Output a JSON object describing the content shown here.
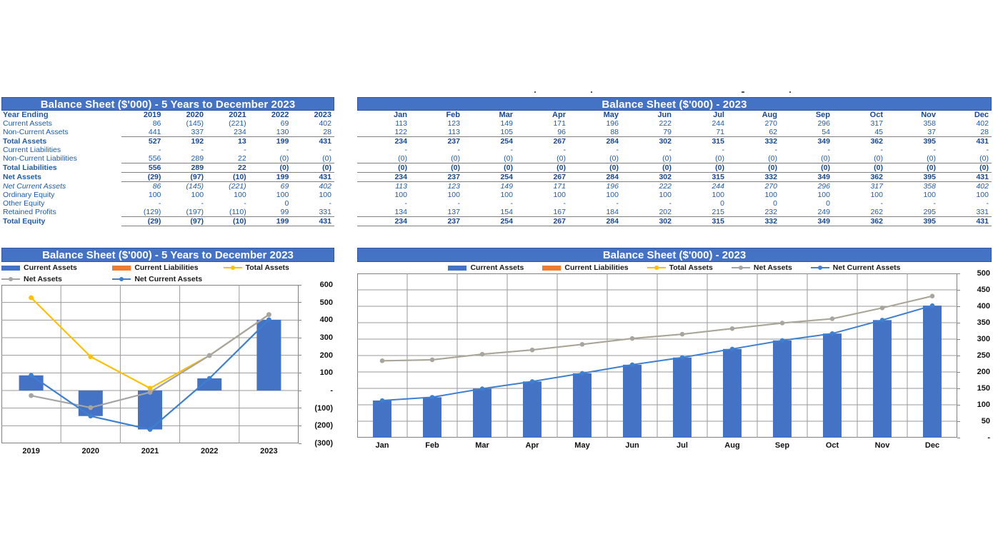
{
  "colors": {
    "header_blue": "#4472C4",
    "text_blue": "#1F5BA8",
    "bar_blue": "#4472C4",
    "series_orange": "#ED7D31",
    "series_yellow": "#FFC000",
    "series_gray": "#A5A5A5",
    "series_blue_line": "#3D7FD1",
    "rule_gray": "#808080"
  },
  "annual_table": {
    "title": "Balance Sheet ($'000) - 5 Years to December 2023",
    "row_header_label": "Year Ending",
    "columns": [
      "2019",
      "2020",
      "2021",
      "2022",
      "2023"
    ],
    "rows": [
      {
        "label": "Current Assets",
        "style": "plain",
        "rule": "none",
        "values": [
          "86",
          "(145)",
          "(221)",
          "69",
          "402"
        ]
      },
      {
        "label": "Non-Current Assets",
        "style": "plain",
        "rule": "bottom",
        "values": [
          "441",
          "337",
          "234",
          "130",
          "28"
        ]
      },
      {
        "label": "Total Assets",
        "style": "bold",
        "rule": "none",
        "values": [
          "527",
          "192",
          "13",
          "199",
          "431"
        ]
      },
      {
        "label": "Current Liabilities",
        "style": "plain",
        "rule": "none",
        "values": [
          "-",
          "-",
          "-",
          "-",
          "-"
        ]
      },
      {
        "label": "Non-Current Liabilities",
        "style": "plain",
        "rule": "bottom",
        "values": [
          "556",
          "289",
          "22",
          "(0)",
          "(0)"
        ]
      },
      {
        "label": "Total Liabilities",
        "style": "bold",
        "rule": "bottom",
        "values": [
          "556",
          "289",
          "22",
          "(0)",
          "(0)"
        ]
      },
      {
        "label": "Net Assets",
        "style": "bold",
        "rule": "bottom",
        "values": [
          "(29)",
          "(97)",
          "(10)",
          "199",
          "431"
        ]
      },
      {
        "label": "Net Current Assets",
        "style": "italic",
        "rule": "none",
        "values": [
          "86",
          "(145)",
          "(221)",
          "69",
          "402"
        ]
      },
      {
        "label": "Ordinary Equity",
        "style": "plain",
        "rule": "none",
        "values": [
          "100",
          "100",
          "100",
          "100",
          "100"
        ]
      },
      {
        "label": "Other Equity",
        "style": "plain",
        "rule": "none",
        "values": [
          "-",
          "-",
          "-",
          "0",
          "-"
        ]
      },
      {
        "label": "Retained Profits",
        "style": "plain",
        "rule": "bottom",
        "values": [
          "(129)",
          "(197)",
          "(110)",
          "99",
          "331"
        ]
      },
      {
        "label": "Total Equity",
        "style": "bold",
        "rule": "bottom",
        "values": [
          "(29)",
          "(97)",
          "(10)",
          "199",
          "431"
        ]
      }
    ]
  },
  "monthly_table": {
    "title": "Balance Sheet ($'000) - 2023",
    "columns": [
      "Jan",
      "Feb",
      "Mar",
      "Apr",
      "May",
      "Jun",
      "Jul",
      "Aug",
      "Sep",
      "Oct",
      "Nov",
      "Dec"
    ],
    "rows": [
      {
        "label": "Current Assets",
        "style": "plain",
        "rule": "none",
        "values": [
          "113",
          "123",
          "149",
          "171",
          "196",
          "222",
          "244",
          "270",
          "296",
          "317",
          "358",
          "402"
        ]
      },
      {
        "label": "Non-Current Assets",
        "style": "plain",
        "rule": "bottom",
        "values": [
          "122",
          "113",
          "105",
          "96",
          "88",
          "79",
          "71",
          "62",
          "54",
          "45",
          "37",
          "28"
        ]
      },
      {
        "label": "Total Assets",
        "style": "bold",
        "rule": "none",
        "values": [
          "234",
          "237",
          "254",
          "267",
          "284",
          "302",
          "315",
          "332",
          "349",
          "362",
          "395",
          "431"
        ]
      },
      {
        "label": "Current Liabilities",
        "style": "plain",
        "rule": "none",
        "values": [
          "-",
          "-",
          "-",
          "-",
          "-",
          "-",
          "-",
          "-",
          "-",
          "-",
          "-",
          "-"
        ]
      },
      {
        "label": "Non-Current Liabilities",
        "style": "plain",
        "rule": "bottom",
        "values": [
          "(0)",
          "(0)",
          "(0)",
          "(0)",
          "(0)",
          "(0)",
          "(0)",
          "(0)",
          "(0)",
          "(0)",
          "(0)",
          "(0)"
        ]
      },
      {
        "label": "Total Liabilities",
        "style": "bold",
        "rule": "bottom",
        "values": [
          "(0)",
          "(0)",
          "(0)",
          "(0)",
          "(0)",
          "(0)",
          "(0)",
          "(0)",
          "(0)",
          "(0)",
          "(0)",
          "(0)"
        ]
      },
      {
        "label": "Net Assets",
        "style": "bold",
        "rule": "bottom",
        "values": [
          "234",
          "237",
          "254",
          "267",
          "284",
          "302",
          "315",
          "332",
          "349",
          "362",
          "395",
          "431"
        ]
      },
      {
        "label": "Net Current Assets",
        "style": "italic",
        "rule": "none",
        "values": [
          "113",
          "123",
          "149",
          "171",
          "196",
          "222",
          "244",
          "270",
          "296",
          "317",
          "358",
          "402"
        ]
      },
      {
        "label": "Ordinary Equity",
        "style": "plain",
        "rule": "none",
        "values": [
          "100",
          "100",
          "100",
          "100",
          "100",
          "100",
          "100",
          "100",
          "100",
          "100",
          "100",
          "100"
        ]
      },
      {
        "label": "Other Equity",
        "style": "plain",
        "rule": "none",
        "values": [
          "-",
          "-",
          "-",
          "-",
          "-",
          "-",
          "0",
          "0",
          "0",
          "-",
          "-",
          "-"
        ]
      },
      {
        "label": "Retained Profits",
        "style": "plain",
        "rule": "bottom",
        "values": [
          "134",
          "137",
          "154",
          "167",
          "184",
          "202",
          "215",
          "232",
          "249",
          "262",
          "295",
          "331"
        ]
      },
      {
        "label": "Total Equity",
        "style": "bold",
        "rule": "bottom",
        "values": [
          "234",
          "237",
          "254",
          "267",
          "284",
          "302",
          "315",
          "332",
          "349",
          "362",
          "395",
          "431"
        ]
      }
    ]
  },
  "chart_data": [
    {
      "id": "annual_chart",
      "type": "bar",
      "title": "Balance Sheet ($'000) - 5 Years to December 2023",
      "categories": [
        "2019",
        "2020",
        "2021",
        "2022",
        "2023"
      ],
      "xlabel": "",
      "ylabel": "",
      "ylim": [
        -300,
        600
      ],
      "yticks": [
        600,
        500,
        400,
        300,
        200,
        100,
        0,
        -100,
        -200,
        -300
      ],
      "ytick_labels": [
        "600",
        "500",
        "400",
        "300",
        "200",
        "100",
        "-",
        "(100)",
        "(200)",
        "(300)"
      ],
      "grid": true,
      "legend_position": "top",
      "series": [
        {
          "name": "Current Assets",
          "kind": "bar",
          "color": "#4472C4",
          "values": [
            86,
            -145,
            -221,
            69,
            402
          ]
        },
        {
          "name": "Current Liabilities",
          "kind": "bar",
          "color": "#ED7D31",
          "values": [
            0,
            0,
            0,
            0,
            0
          ]
        },
        {
          "name": "Total Assets",
          "kind": "line",
          "color": "#FFC000",
          "values": [
            527,
            192,
            13,
            199,
            431
          ]
        },
        {
          "name": "Net Assets",
          "kind": "line",
          "color": "#A5A5A5",
          "values": [
            -29,
            -97,
            -10,
            199,
            431
          ]
        },
        {
          "name": "Net Current Assets",
          "kind": "line",
          "color": "#3D7FD1",
          "values": [
            86,
            -145,
            -221,
            69,
            402
          ]
        }
      ]
    },
    {
      "id": "monthly_chart",
      "type": "bar",
      "title": "Balance Sheet ($'000) - 2023",
      "categories": [
        "Jan",
        "Feb",
        "Mar",
        "Apr",
        "May",
        "Jun",
        "Jul",
        "Aug",
        "Sep",
        "Oct",
        "Nov",
        "Dec"
      ],
      "xlabel": "",
      "ylabel": "",
      "ylim": [
        0,
        500
      ],
      "yticks": [
        500,
        450,
        400,
        350,
        300,
        250,
        200,
        150,
        100,
        50,
        0
      ],
      "ytick_labels": [
        "500",
        "450",
        "400",
        "350",
        "300",
        "250",
        "200",
        "150",
        "100",
        "50",
        "-"
      ],
      "grid": true,
      "legend_position": "top",
      "series": [
        {
          "name": "Current Assets",
          "kind": "bar",
          "color": "#4472C4",
          "values": [
            113,
            123,
            149,
            171,
            196,
            222,
            244,
            270,
            296,
            317,
            358,
            402
          ]
        },
        {
          "name": "Current Liabilities",
          "kind": "bar",
          "color": "#ED7D31",
          "values": [
            0,
            0,
            0,
            0,
            0,
            0,
            0,
            0,
            0,
            0,
            0,
            0
          ]
        },
        {
          "name": "Total Assets",
          "kind": "line",
          "color": "#FFC000",
          "values": [
            234,
            237,
            254,
            267,
            284,
            302,
            315,
            332,
            349,
            362,
            395,
            431
          ]
        },
        {
          "name": "Net Assets",
          "kind": "line",
          "color": "#A5A5A5",
          "values": [
            234,
            237,
            254,
            267,
            284,
            302,
            315,
            332,
            349,
            362,
            395,
            431
          ]
        },
        {
          "name": "Net Current Assets",
          "kind": "line",
          "color": "#3D7FD1",
          "values": [
            113,
            123,
            149,
            171,
            196,
            222,
            244,
            270,
            296,
            317,
            358,
            402
          ]
        }
      ]
    }
  ]
}
